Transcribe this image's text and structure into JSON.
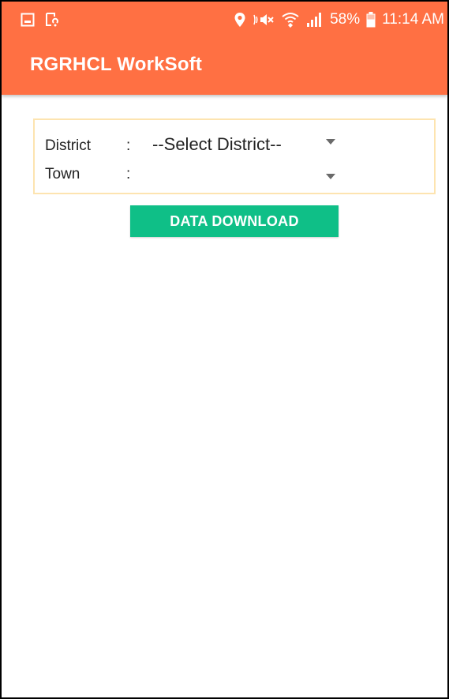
{
  "status_bar": {
    "left_icons": [
      "image-icon",
      "cast-icon"
    ],
    "right_icons": [
      "location-icon",
      "mute-icon",
      "wifi-icon",
      "signal-icon",
      "battery-icon"
    ],
    "battery": "58%",
    "time": "11:14 AM"
  },
  "app_bar": {
    "title": "RGRHCL WorkSoft",
    "color": "#ff7043"
  },
  "form": {
    "district": {
      "label": "District",
      "colon": ":",
      "selected": "--Select District--"
    },
    "town": {
      "label": "Town",
      "colon": ":",
      "selected": ""
    }
  },
  "actions": {
    "download_label": "DATA DOWNLOAD",
    "download_color": "#0fbf87"
  }
}
